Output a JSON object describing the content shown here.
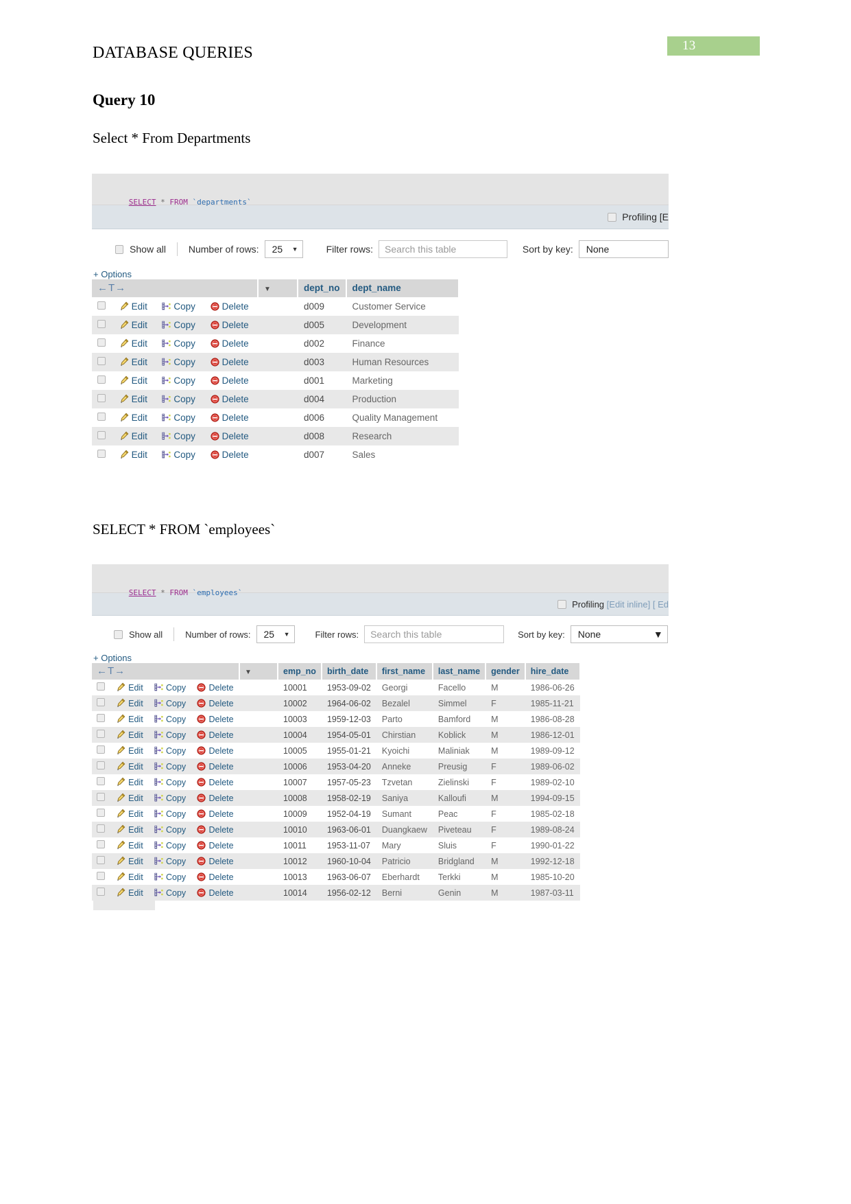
{
  "page": {
    "badge_number": "13",
    "doc_title": "DATABASE QUERIES",
    "query_title": "Query 10",
    "subtitle_departments": "Select * From Departments",
    "subtitle_employees": "SELECT * FROM `employees`",
    "badge_color": "#a8d08d"
  },
  "departments_shot": {
    "sql": {
      "keyword_select": "SELECT",
      "star": "*",
      "keyword_from": "FROM",
      "identifier": "`departments`"
    },
    "profiling": {
      "label": "Profiling [E"
    },
    "toolbar": {
      "show_all": "Show all",
      "number_of_rows_label": "Number of rows:",
      "number_of_rows_value": "25",
      "filter_rows_label": "Filter rows:",
      "filter_rows_placeholder": "Search this table",
      "sort_by_key_label": "Sort by key:",
      "sort_by_key_value": "None"
    },
    "options_link": "+ Options",
    "actions": {
      "edit": "Edit",
      "copy": "Copy",
      "delete": "Delete"
    },
    "columns": [
      "dept_no",
      "dept_name"
    ],
    "rows": [
      {
        "dept_no": "d009",
        "dept_name": "Customer Service"
      },
      {
        "dept_no": "d005",
        "dept_name": "Development"
      },
      {
        "dept_no": "d002",
        "dept_name": "Finance"
      },
      {
        "dept_no": "d003",
        "dept_name": "Human Resources"
      },
      {
        "dept_no": "d001",
        "dept_name": "Marketing"
      },
      {
        "dept_no": "d004",
        "dept_name": "Production"
      },
      {
        "dept_no": "d006",
        "dept_name": "Quality Management"
      },
      {
        "dept_no": "d008",
        "dept_name": "Research"
      },
      {
        "dept_no": "d007",
        "dept_name": "Sales"
      }
    ]
  },
  "employees_shot": {
    "sql": {
      "keyword_select": "SELECT",
      "star": "*",
      "keyword_from": "FROM",
      "identifier": "`employees`"
    },
    "profiling": {
      "label": "Profiling",
      "edit_inline": "[Edit inline]",
      "trailing": "[ Ed"
    },
    "toolbar": {
      "show_all": "Show all",
      "number_of_rows_label": "Number of rows:",
      "number_of_rows_value": "25",
      "filter_rows_label": "Filter rows:",
      "filter_rows_placeholder": "Search this table",
      "sort_by_key_label": "Sort by key:",
      "sort_by_key_value": "None"
    },
    "options_link": "+ Options",
    "actions": {
      "edit": "Edit",
      "copy": "Copy",
      "delete": "Delete"
    },
    "columns": [
      "emp_no",
      "birth_date",
      "first_name",
      "last_name",
      "gender",
      "hire_date"
    ],
    "rows": [
      {
        "emp_no": "10001",
        "birth_date": "1953-09-02",
        "first_name": "Georgi",
        "last_name": "Facello",
        "gender": "M",
        "hire_date": "1986-06-26"
      },
      {
        "emp_no": "10002",
        "birth_date": "1964-06-02",
        "first_name": "Bezalel",
        "last_name": "Simmel",
        "gender": "F",
        "hire_date": "1985-11-21"
      },
      {
        "emp_no": "10003",
        "birth_date": "1959-12-03",
        "first_name": "Parto",
        "last_name": "Bamford",
        "gender": "M",
        "hire_date": "1986-08-28"
      },
      {
        "emp_no": "10004",
        "birth_date": "1954-05-01",
        "first_name": "Chirstian",
        "last_name": "Koblick",
        "gender": "M",
        "hire_date": "1986-12-01"
      },
      {
        "emp_no": "10005",
        "birth_date": "1955-01-21",
        "first_name": "Kyoichi",
        "last_name": "Maliniak",
        "gender": "M",
        "hire_date": "1989-09-12"
      },
      {
        "emp_no": "10006",
        "birth_date": "1953-04-20",
        "first_name": "Anneke",
        "last_name": "Preusig",
        "gender": "F",
        "hire_date": "1989-06-02"
      },
      {
        "emp_no": "10007",
        "birth_date": "1957-05-23",
        "first_name": "Tzvetan",
        "last_name": "Zielinski",
        "gender": "F",
        "hire_date": "1989-02-10"
      },
      {
        "emp_no": "10008",
        "birth_date": "1958-02-19",
        "first_name": "Saniya",
        "last_name": "Kalloufi",
        "gender": "M",
        "hire_date": "1994-09-15"
      },
      {
        "emp_no": "10009",
        "birth_date": "1952-04-19",
        "first_name": "Sumant",
        "last_name": "Peac",
        "gender": "F",
        "hire_date": "1985-02-18"
      },
      {
        "emp_no": "10010",
        "birth_date": "1963-06-01",
        "first_name": "Duangkaew",
        "last_name": "Piveteau",
        "gender": "F",
        "hire_date": "1989-08-24"
      },
      {
        "emp_no": "10011",
        "birth_date": "1953-11-07",
        "first_name": "Mary",
        "last_name": "Sluis",
        "gender": "F",
        "hire_date": "1990-01-22"
      },
      {
        "emp_no": "10012",
        "birth_date": "1960-10-04",
        "first_name": "Patricio",
        "last_name": "Bridgland",
        "gender": "M",
        "hire_date": "1992-12-18"
      },
      {
        "emp_no": "10013",
        "birth_date": "1963-06-07",
        "first_name": "Eberhardt",
        "last_name": "Terkki",
        "gender": "M",
        "hire_date": "1985-10-20"
      },
      {
        "emp_no": "10014",
        "birth_date": "1956-02-12",
        "first_name": "Berni",
        "last_name": "Genin",
        "gender": "M",
        "hire_date": "1987-03-11"
      }
    ]
  }
}
